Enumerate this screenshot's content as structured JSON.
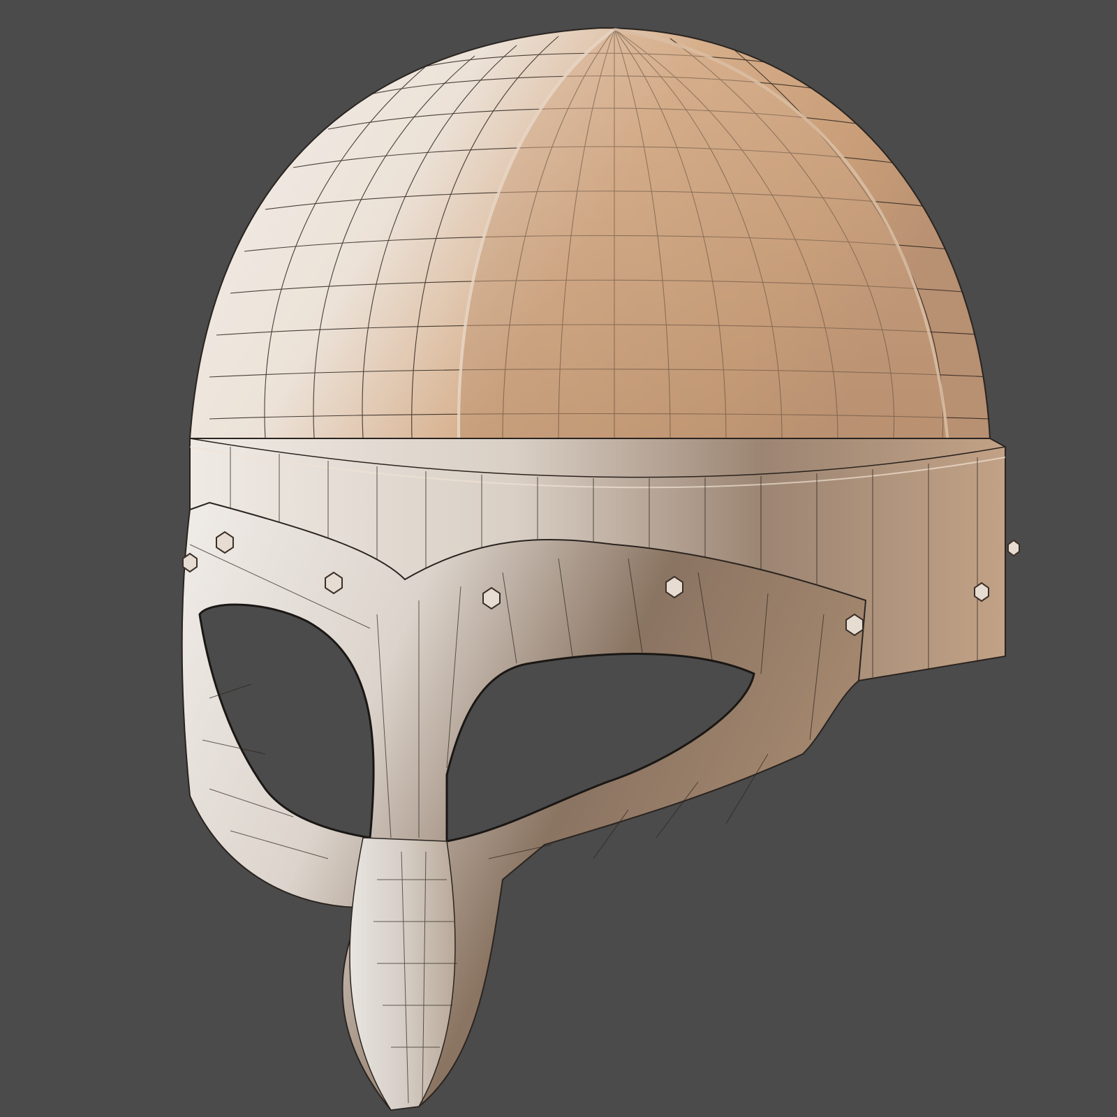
{
  "viewport": {
    "background_color": "#4b4b4b"
  },
  "model": {
    "subject": "helmet-wireframe-render",
    "base_color_light": "#f1ece7",
    "base_color_warm": "#c79d79",
    "shadow_color": "#6f5a49",
    "wire_color": "#1e1a17",
    "rivet_color": "#e6dcd2",
    "rivet_count": 8
  }
}
